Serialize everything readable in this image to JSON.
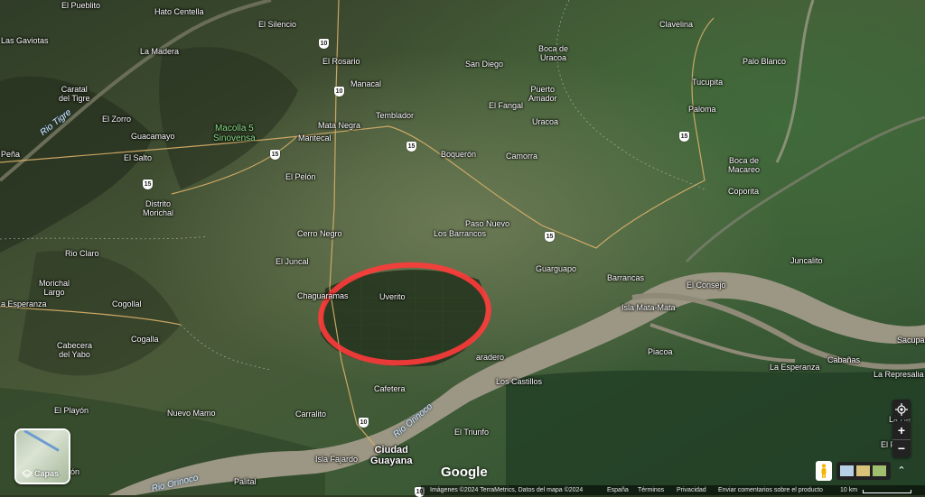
{
  "places": [
    {
      "id": "el-pueblito",
      "text": "El Pueblito"
    },
    {
      "id": "hato-centella",
      "text": "Hato Centella"
    },
    {
      "id": "el-silencio",
      "text": "El Silencio"
    },
    {
      "id": "clavelina",
      "text": "Clavelina"
    },
    {
      "id": "las-gaviotas",
      "text": "Las Gaviotas"
    },
    {
      "id": "la-madera",
      "text": "La Madera"
    },
    {
      "id": "el-rosario",
      "text": "El Rosario"
    },
    {
      "id": "boca-de-uracoa",
      "text": "Boca de\nUracoa"
    },
    {
      "id": "san-diego",
      "text": "San Diego"
    },
    {
      "id": "palo-blanco",
      "text": "Palo Blanco"
    },
    {
      "id": "caratal-del-tigre",
      "text": "Caratal\ndel Tigre"
    },
    {
      "id": "manacal",
      "text": "Manacal"
    },
    {
      "id": "puerto-amador",
      "text": "Puerto\nAmador"
    },
    {
      "id": "tucupita",
      "text": "Tucupita"
    },
    {
      "id": "el-fangal",
      "text": "El Fangal"
    },
    {
      "id": "el-zorro",
      "text": "El Zorro"
    },
    {
      "id": "macolla-5",
      "text": "Macolla 5\nSinovensa"
    },
    {
      "id": "temblador",
      "text": "Temblador"
    },
    {
      "id": "uracoa",
      "text": "Uracoa"
    },
    {
      "id": "paloma",
      "text": "Paloma"
    },
    {
      "id": "mata-negra",
      "text": "Mata Negra"
    },
    {
      "id": "guacamayo",
      "text": "Guacamayo"
    },
    {
      "id": "mantecal",
      "text": "Mantecal"
    },
    {
      "id": "pena",
      "text": "Peña"
    },
    {
      "id": "el-salto",
      "text": "El Salto"
    },
    {
      "id": "boqueron",
      "text": "Boquerón"
    },
    {
      "id": "camorra",
      "text": "Camorra"
    },
    {
      "id": "boca-de-macareo",
      "text": "Boca de\nMacareo"
    },
    {
      "id": "el-pelon",
      "text": "El Pelón"
    },
    {
      "id": "coporita",
      "text": "Coporita"
    },
    {
      "id": "distrito-morichal",
      "text": "Distrito\nMorichal"
    },
    {
      "id": "paso-nuevo",
      "text": "Paso Nuevo"
    },
    {
      "id": "cerro-negro",
      "text": "Cerro Negro"
    },
    {
      "id": "los-barrancos",
      "text": "Los Barrancos"
    },
    {
      "id": "rio-claro",
      "text": "Rio Claro"
    },
    {
      "id": "juncalito",
      "text": "Juncalito"
    },
    {
      "id": "el-juncal",
      "text": "El Juncal"
    },
    {
      "id": "guarguapo",
      "text": "Guarguapo"
    },
    {
      "id": "barrancas",
      "text": "Barrancas"
    },
    {
      "id": "morichal-largo",
      "text": "Morichal\nLargo"
    },
    {
      "id": "el-consejo",
      "text": "El Consejo"
    },
    {
      "id": "chaguaramas",
      "text": "Chaguaramas"
    },
    {
      "id": "uverito",
      "text": "Uverito"
    },
    {
      "id": "la-esperanza-w",
      "text": "a Esperanza"
    },
    {
      "id": "cogollal",
      "text": "Cogollal"
    },
    {
      "id": "isla-mata-mata",
      "text": "Isla Mata-Mata"
    },
    {
      "id": "sacupana",
      "text": "Sacupar"
    },
    {
      "id": "cogalla",
      "text": "Cogalla"
    },
    {
      "id": "piacoa",
      "text": "Piacoa"
    },
    {
      "id": "cabecera-del-yabo",
      "text": "Cabecera\ndel Yabo"
    },
    {
      "id": "paradero",
      "text": "aradero"
    },
    {
      "id": "cabanas",
      "text": "Cabañas"
    },
    {
      "id": "la-esperanza-e",
      "text": "La Esperanza"
    },
    {
      "id": "la-represalia",
      "text": "La Represalia"
    },
    {
      "id": "los-castillos",
      "text": "Los Castillos"
    },
    {
      "id": "cafetera",
      "text": "Cafetera"
    },
    {
      "id": "el-playon",
      "text": "El Playón"
    },
    {
      "id": "nuevo-mamo",
      "text": "Nuevo Mamo"
    },
    {
      "id": "carralito",
      "text": "Carralito"
    },
    {
      "id": "la-herradura",
      "text": "La He"
    },
    {
      "id": "el-triunfo",
      "text": "El Triunfo"
    },
    {
      "id": "ciudad-guayana",
      "text": "Ciudad\nGuayana"
    },
    {
      "id": "el-f",
      "text": "El F"
    },
    {
      "id": "isla-fajardo",
      "text": "Isla Fajardo"
    },
    {
      "id": "palital",
      "text": "Palital"
    },
    {
      "id": "salon",
      "text": "alón"
    }
  ],
  "rivers": [
    {
      "id": "rio-tigre",
      "text": "Rio Tigre"
    },
    {
      "id": "rio-orinoco-1",
      "text": "Rio Orinoco"
    },
    {
      "id": "rio-orinoco-2",
      "text": "Rio Orinoco"
    }
  ],
  "route_shields": [
    "10",
    "10",
    "15",
    "15",
    "15",
    "15",
    "15",
    "10",
    "10"
  ],
  "highlight_color": "#ff3b3b",
  "brand": "Google",
  "controls": {
    "layers_label": "Capas",
    "zoom_in": "+",
    "zoom_out": "−",
    "expand": "⌃"
  },
  "footer": {
    "imagery": "Imágenes ©2024 TerraMetrics, Datos del mapa ©2024",
    "country": "España",
    "terms": "Términos",
    "privacy": "Privacidad",
    "feedback": "Enviar comentarios sobre el producto",
    "scale": "10 km"
  }
}
